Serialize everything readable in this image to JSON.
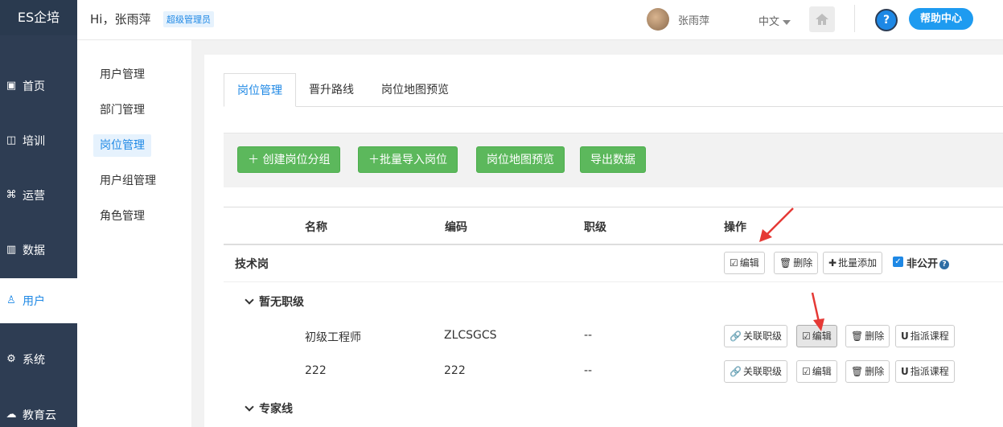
{
  "brand": "ES企培",
  "leftnav": [
    {
      "icon": "chart-icon",
      "glyph": "▣",
      "label": "首页"
    },
    {
      "icon": "book-icon",
      "glyph": "◫",
      "label": "培训"
    },
    {
      "icon": "command-icon",
      "glyph": "⌘",
      "label": "运营"
    },
    {
      "icon": "bar-chart-icon",
      "glyph": "▥",
      "label": "数据"
    },
    {
      "icon": "user-icon",
      "glyph": "♙",
      "label": "用户"
    },
    {
      "icon": "gear-icon",
      "glyph": "⚙",
      "label": "系统"
    },
    {
      "icon": "cloud-icon",
      "glyph": "☁",
      "label": "教育云"
    }
  ],
  "header": {
    "greeting": "Hi，张雨萍",
    "role": "超级管理员",
    "username": "张雨萍",
    "language": "中文",
    "help": "帮助中心",
    "help_icon": "?"
  },
  "subnav": [
    "用户管理",
    "部门管理",
    "岗位管理",
    "用户组管理",
    "角色管理"
  ],
  "tabs": [
    "岗位管理",
    "晋升路线",
    "岗位地图预览"
  ],
  "toolbar": {
    "create_group": "＋ 创建岗位分组",
    "batch_import": "＋批量导入岗位",
    "map_preview": "岗位地图预览",
    "export": "导出数据"
  },
  "table": {
    "headers": [
      "名称",
      "编码",
      "职级",
      "操作"
    ],
    "group": {
      "name": "技术岗",
      "edit": "编辑",
      "delete": "删除",
      "batch_add": "批量添加",
      "private_label": "非公开",
      "private_checked": true
    },
    "subgroup1": "暂无职级",
    "rows": [
      {
        "name": "初级工程师",
        "code": "ZLCSGCS",
        "level": "--",
        "link": "关联职级",
        "edit": "编辑",
        "delete": "删除",
        "assign": "指派课程"
      },
      {
        "name": "222",
        "code": "222",
        "level": "--",
        "link": "关联职级",
        "edit": "编辑",
        "delete": "删除",
        "assign": "指派课程"
      }
    ],
    "subgroup2": "专家线"
  },
  "colors": {
    "accent": "#1e88e5",
    "green": "#5cb85c",
    "sidebar": "#2e3d53",
    "arrow": "#e53935"
  }
}
